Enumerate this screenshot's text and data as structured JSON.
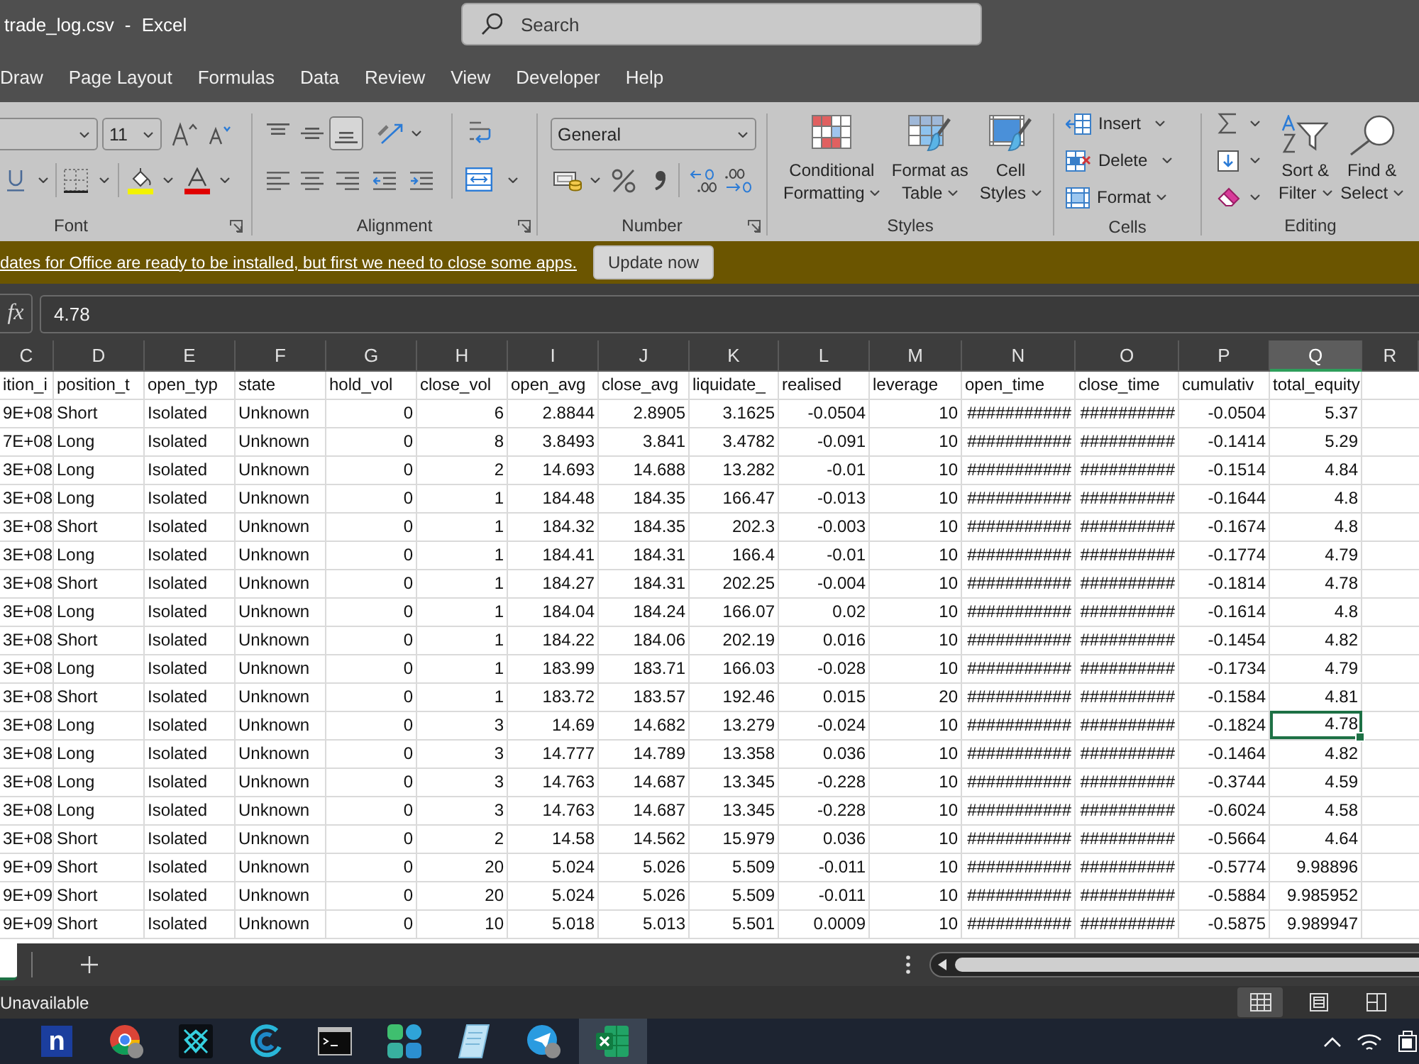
{
  "window": {
    "title": "trade_log.csv - Excel"
  },
  "search": {
    "placeholder": "Search"
  },
  "ribbon_tabs": [
    {
      "label": "Draw",
      "selected": false
    },
    {
      "label": "Page Layout",
      "selected": false
    },
    {
      "label": "Formulas",
      "selected": false
    },
    {
      "label": "Data",
      "selected": false
    },
    {
      "label": "Review",
      "selected": false
    },
    {
      "label": "View",
      "selected": false
    },
    {
      "label": "Developer",
      "selected": false
    },
    {
      "label": "Help",
      "selected": false
    }
  ],
  "ribbon": {
    "font": {
      "label": "Font",
      "size": "11"
    },
    "alignment": {
      "label": "Alignment",
      "vertical": [
        {
          "kind": "top",
          "selected": false
        },
        {
          "kind": "middle",
          "selected": false
        },
        {
          "kind": "bottom",
          "selected": true
        }
      ]
    },
    "number": {
      "label": "Number",
      "format": "General"
    },
    "styles": {
      "label": "Styles",
      "buttons": [
        {
          "kind": "conditional",
          "lines": [
            "Conditional",
            "Formatting"
          ]
        },
        {
          "kind": "table",
          "lines": [
            "Format as",
            "Table"
          ]
        },
        {
          "kind": "cell_styles",
          "lines": [
            "Cell",
            "Styles"
          ]
        }
      ]
    },
    "cells": {
      "label": "Cells",
      "buttons": [
        {
          "kind": "insert",
          "label": "Insert"
        },
        {
          "kind": "delete",
          "label": "Delete"
        },
        {
          "kind": "format",
          "label": "Format"
        }
      ]
    },
    "editing": {
      "label": "Editing",
      "buttons": [
        {
          "kind": "sort_filter",
          "lines": [
            "Sort &",
            "Filter"
          ]
        },
        {
          "kind": "find_select",
          "lines": [
            "Find &",
            "Select"
          ]
        }
      ]
    }
  },
  "update_bar": {
    "message": "dates for Office are ready to be installed, but first we need to close some apps.",
    "button": "Update now"
  },
  "formula_bar": {
    "function_button": "fx",
    "value": "4.78"
  },
  "sheet": {
    "columns": [
      {
        "letter": "C",
        "kind": "number",
        "selected": false
      },
      {
        "letter": "D",
        "kind": "text",
        "selected": false
      },
      {
        "letter": "E",
        "kind": "text",
        "selected": false
      },
      {
        "letter": "F",
        "kind": "text",
        "selected": false
      },
      {
        "letter": "G",
        "kind": "number",
        "selected": false
      },
      {
        "letter": "H",
        "kind": "number",
        "selected": false
      },
      {
        "letter": "I",
        "kind": "number",
        "selected": false
      },
      {
        "letter": "J",
        "kind": "number",
        "selected": false
      },
      {
        "letter": "K",
        "kind": "number",
        "selected": false
      },
      {
        "letter": "L",
        "kind": "number",
        "selected": false
      },
      {
        "letter": "M",
        "kind": "number",
        "selected": false
      },
      {
        "letter": "N",
        "kind": "number",
        "selected": false
      },
      {
        "letter": "O",
        "kind": "number",
        "selected": false
      },
      {
        "letter": "P",
        "kind": "number",
        "selected": false
      },
      {
        "letter": "Q",
        "kind": "number",
        "selected": true
      },
      {
        "letter": "R",
        "kind": "text",
        "selected": false
      }
    ],
    "header_row": [
      "ition_i",
      "position_t",
      "open_typ",
      "state",
      "hold_vol",
      "close_vol",
      "open_avg",
      "close_avg",
      "liquidate_",
      "realised",
      "leverage",
      "open_time",
      "close_time",
      "cumulativ",
      "total_equity"
    ],
    "rows": [
      {
        "selected": false,
        "cells": [
          "9E+08",
          "Short",
          "Isolated",
          "Unknown",
          "0",
          "6",
          "2.8844",
          "2.8905",
          "3.1625",
          "-0.0504",
          "10",
          "###########",
          "##########",
          "-0.0504",
          "5.37"
        ]
      },
      {
        "selected": false,
        "cells": [
          "7E+08",
          "Long",
          "Isolated",
          "Unknown",
          "0",
          "8",
          "3.8493",
          "3.841",
          "3.4782",
          "-0.091",
          "10",
          "###########",
          "##########",
          "-0.1414",
          "5.29"
        ]
      },
      {
        "selected": false,
        "cells": [
          "3E+08",
          "Long",
          "Isolated",
          "Unknown",
          "0",
          "2",
          "14.693",
          "14.688",
          "13.282",
          "-0.01",
          "10",
          "###########",
          "##########",
          "-0.1514",
          "4.84"
        ]
      },
      {
        "selected": false,
        "cells": [
          "3E+08",
          "Long",
          "Isolated",
          "Unknown",
          "0",
          "1",
          "184.48",
          "184.35",
          "166.47",
          "-0.013",
          "10",
          "###########",
          "##########",
          "-0.1644",
          "4.8"
        ]
      },
      {
        "selected": false,
        "cells": [
          "3E+08",
          "Short",
          "Isolated",
          "Unknown",
          "0",
          "1",
          "184.32",
          "184.35",
          "202.3",
          "-0.003",
          "10",
          "###########",
          "##########",
          "-0.1674",
          "4.8"
        ]
      },
      {
        "selected": false,
        "cells": [
          "3E+08",
          "Long",
          "Isolated",
          "Unknown",
          "0",
          "1",
          "184.41",
          "184.31",
          "166.4",
          "-0.01",
          "10",
          "###########",
          "##########",
          "-0.1774",
          "4.79"
        ]
      },
      {
        "selected": false,
        "cells": [
          "3E+08",
          "Short",
          "Isolated",
          "Unknown",
          "0",
          "1",
          "184.27",
          "184.31",
          "202.25",
          "-0.004",
          "10",
          "###########",
          "##########",
          "-0.1814",
          "4.78"
        ]
      },
      {
        "selected": false,
        "cells": [
          "3E+08",
          "Long",
          "Isolated",
          "Unknown",
          "0",
          "1",
          "184.04",
          "184.24",
          "166.07",
          "0.02",
          "10",
          "###########",
          "##########",
          "-0.1614",
          "4.8"
        ]
      },
      {
        "selected": false,
        "cells": [
          "3E+08",
          "Short",
          "Isolated",
          "Unknown",
          "0",
          "1",
          "184.22",
          "184.06",
          "202.19",
          "0.016",
          "10",
          "###########",
          "##########",
          "-0.1454",
          "4.82"
        ]
      },
      {
        "selected": false,
        "cells": [
          "3E+08",
          "Long",
          "Isolated",
          "Unknown",
          "0",
          "1",
          "183.99",
          "183.71",
          "166.03",
          "-0.028",
          "10",
          "###########",
          "##########",
          "-0.1734",
          "4.79"
        ]
      },
      {
        "selected": false,
        "cells": [
          "3E+08",
          "Short",
          "Isolated",
          "Unknown",
          "0",
          "1",
          "183.72",
          "183.57",
          "192.46",
          "0.015",
          "20",
          "###########",
          "##########",
          "-0.1584",
          "4.81"
        ]
      },
      {
        "selected": true,
        "cells": [
          "3E+08",
          "Long",
          "Isolated",
          "Unknown",
          "0",
          "3",
          "14.69",
          "14.682",
          "13.279",
          "-0.024",
          "10",
          "###########",
          "##########",
          "-0.1824",
          "4.78"
        ]
      },
      {
        "selected": false,
        "cells": [
          "3E+08",
          "Long",
          "Isolated",
          "Unknown",
          "0",
          "3",
          "14.777",
          "14.789",
          "13.358",
          "0.036",
          "10",
          "###########",
          "##########",
          "-0.1464",
          "4.82"
        ]
      },
      {
        "selected": false,
        "cells": [
          "3E+08",
          "Long",
          "Isolated",
          "Unknown",
          "0",
          "3",
          "14.763",
          "14.687",
          "13.345",
          "-0.228",
          "10",
          "###########",
          "##########",
          "-0.3744",
          "4.59"
        ]
      },
      {
        "selected": false,
        "cells": [
          "3E+08",
          "Long",
          "Isolated",
          "Unknown",
          "0",
          "3",
          "14.763",
          "14.687",
          "13.345",
          "-0.228",
          "10",
          "###########",
          "##########",
          "-0.6024",
          "4.58"
        ]
      },
      {
        "selected": false,
        "cells": [
          "3E+08",
          "Short",
          "Isolated",
          "Unknown",
          "0",
          "2",
          "14.58",
          "14.562",
          "15.979",
          "0.036",
          "10",
          "###########",
          "##########",
          "-0.5664",
          "4.64"
        ]
      },
      {
        "selected": false,
        "cells": [
          "9E+09",
          "Short",
          "Isolated",
          "Unknown",
          "0",
          "20",
          "5.024",
          "5.026",
          "5.509",
          "-0.011",
          "10",
          "###########",
          "##########",
          "-0.5774",
          "9.98896"
        ]
      },
      {
        "selected": false,
        "cells": [
          "9E+09",
          "Short",
          "Isolated",
          "Unknown",
          "0",
          "20",
          "5.024",
          "5.026",
          "5.509",
          "-0.011",
          "10",
          "###########",
          "##########",
          "-0.5884",
          "9.985952"
        ]
      },
      {
        "selected": false,
        "cells": [
          "9E+09",
          "Short",
          "Isolated",
          "Unknown",
          "0",
          "10",
          "5.018",
          "5.013",
          "5.501",
          "0.0009",
          "10",
          "###########",
          "##########",
          "-0.5875",
          "9.989947"
        ]
      }
    ]
  },
  "status_bar": {
    "text": "Unavailable",
    "views": [
      {
        "kind": "normal",
        "selected": true
      },
      {
        "kind": "page_layout",
        "selected": false
      },
      {
        "kind": "page_break",
        "selected": false
      }
    ]
  },
  "taskbar": {
    "apps": [
      {
        "kind": "letter",
        "letter": "n",
        "selected": false
      },
      {
        "kind": "browser",
        "selected": false
      },
      {
        "kind": "diamond",
        "selected": false
      },
      {
        "kind": "swirl",
        "selected": false
      },
      {
        "kind": "terminal",
        "selected": false
      },
      {
        "kind": "tiles",
        "selected": false
      },
      {
        "kind": "notepad",
        "selected": false
      },
      {
        "kind": "plane",
        "selected": false
      },
      {
        "kind": "spreadsheet",
        "selected": true
      }
    ]
  }
}
